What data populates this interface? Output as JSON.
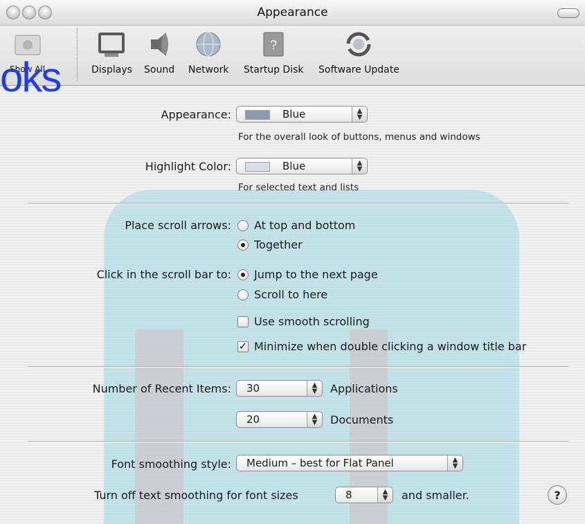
{
  "window": {
    "title": "Appearance"
  },
  "toolbar": {
    "items": [
      {
        "label": "Show All",
        "icon": "apple-icon"
      },
      {
        "label": "Displays",
        "icon": "display-icon"
      },
      {
        "label": "Sound",
        "icon": "speaker-icon"
      },
      {
        "label": "Network",
        "icon": "globe-icon"
      },
      {
        "label": "Startup Disk",
        "icon": "disk-icon"
      },
      {
        "label": "Software Update",
        "icon": "refresh-icon"
      }
    ],
    "watermark_text": "oks"
  },
  "appearance": {
    "label": "Appearance:",
    "value": "Blue",
    "hint": "For the overall look of buttons, menus and windows",
    "swatch_color": "#8c9aad"
  },
  "highlight": {
    "label": "Highlight Color:",
    "value": "Blue",
    "hint": "For selected text and lists",
    "swatch_color": "#d9dde4"
  },
  "scroll_arrows": {
    "label": "Place scroll arrows:",
    "options": [
      "At top and bottom",
      "Together"
    ],
    "selected": "Together"
  },
  "scroll_click": {
    "label": "Click in the scroll bar to:",
    "options": [
      "Jump to the next page",
      "Scroll to here"
    ],
    "selected": "Jump to the next page"
  },
  "smooth_scrolling": {
    "label": "Use smooth scrolling",
    "checked": false
  },
  "minimize_double_click": {
    "label": "Minimize when double clicking a window title bar",
    "checked": true
  },
  "recent_items": {
    "label": "Number of Recent Items:",
    "applications_value": "30",
    "applications_label": "Applications",
    "documents_value": "20",
    "documents_label": "Documents"
  },
  "font_smoothing": {
    "label": "Font smoothing style:",
    "value": "Medium – best for Flat Panel"
  },
  "text_smoothing": {
    "prefix": "Turn off text smoothing for font sizes",
    "value": "8",
    "suffix": "and smaller."
  },
  "help": {
    "label": "?"
  }
}
